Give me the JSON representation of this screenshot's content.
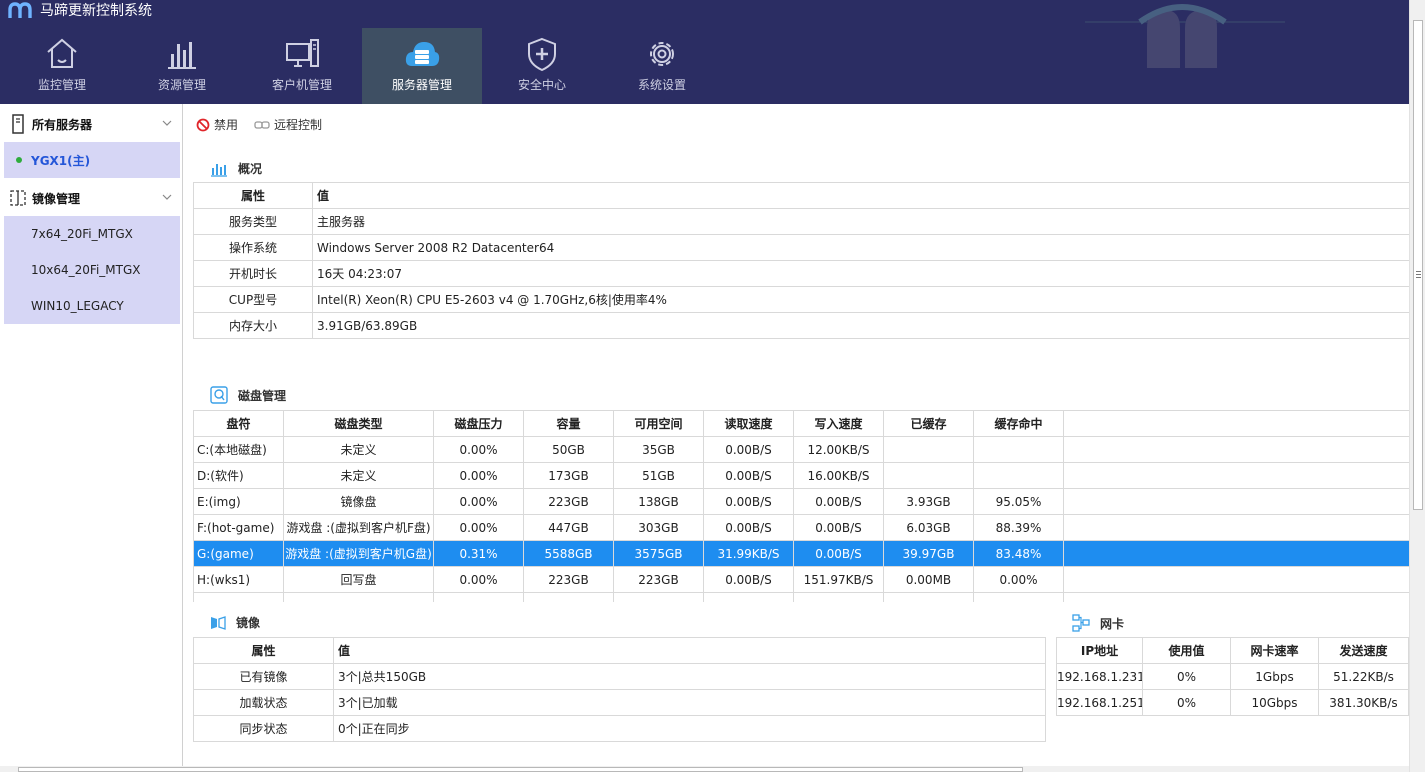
{
  "app": {
    "title": "马蹄更新控制系统"
  },
  "nav": [
    {
      "label": "监控管理",
      "icon": "home-icon",
      "active": false
    },
    {
      "label": "资源管理",
      "icon": "bar-chart-icon",
      "active": false
    },
    {
      "label": "客户机管理",
      "icon": "monitor-icon",
      "active": false
    },
    {
      "label": "服务器管理",
      "icon": "cloud-server-icon",
      "active": true
    },
    {
      "label": "安全中心",
      "icon": "shield-icon",
      "active": false
    },
    {
      "label": "系统设置",
      "icon": "gear-icon",
      "active": false
    }
  ],
  "sidebar": {
    "servers_group": "所有服务器",
    "server": "YGX1(主)",
    "images_group": "镜像管理",
    "images": [
      "7x64_20Fi_MTGX",
      "10x64_20Fi_MTGX",
      "WIN10_LEGACY"
    ]
  },
  "toolbar": {
    "disable": "禁用",
    "remote": "远程控制"
  },
  "overview": {
    "title": "概况",
    "headers": [
      "属性",
      "值"
    ],
    "rows": [
      [
        "服务类型",
        "主服务器"
      ],
      [
        "操作系统",
        "Windows Server 2008 R2 Datacenter64"
      ],
      [
        "开机时长",
        "16天 04:23:07"
      ],
      [
        "CUP型号",
        "Intel(R) Xeon(R) CPU E5-2603 v4 @ 1.70GHz,6核|使用率4%"
      ],
      [
        "内存大小",
        "3.91GB/63.89GB"
      ]
    ]
  },
  "disk": {
    "title": "磁盘管理",
    "headers": [
      "盘符",
      "磁盘类型",
      "磁盘压力",
      "容量",
      "可用空间",
      "读取速度",
      "写入速度",
      "已缓存",
      "缓存命中"
    ],
    "rows": [
      [
        "C:(本地磁盘)",
        "未定义",
        "0.00%",
        "50GB",
        "35GB",
        "0.00B/S",
        "12.00KB/S",
        "",
        ""
      ],
      [
        "D:(软件)",
        "未定义",
        "0.00%",
        "173GB",
        "51GB",
        "0.00B/S",
        "16.00KB/S",
        "",
        ""
      ],
      [
        "E:(img)",
        "镜像盘",
        "0.00%",
        "223GB",
        "138GB",
        "0.00B/S",
        "0.00B/S",
        "3.93GB",
        "95.05%"
      ],
      [
        "F:(hot-game)",
        "游戏盘 :(虚拟到客户机F盘)",
        "0.00%",
        "447GB",
        "303GB",
        "0.00B/S",
        "0.00B/S",
        "6.03GB",
        "88.39%"
      ],
      [
        "G:(game)",
        "游戏盘 :(虚拟到客户机G盘)",
        "0.31%",
        "5588GB",
        "3575GB",
        "31.99KB/S",
        "0.00B/S",
        "39.97GB",
        "83.48%"
      ],
      [
        "H:(wks1)",
        "回写盘",
        "0.00%",
        "223GB",
        "223GB",
        "0.00B/S",
        "151.97KB/S",
        "0.00MB",
        "0.00%"
      ]
    ],
    "selected_row": 4
  },
  "mirror": {
    "title": "镜像",
    "headers": [
      "属性",
      "值"
    ],
    "rows": [
      [
        "已有镜像",
        "3个|总共150GB"
      ],
      [
        "加载状态",
        "3个|已加载"
      ],
      [
        "同步状态",
        "0个|正在同步"
      ]
    ]
  },
  "nic": {
    "title": "网卡",
    "headers": [
      "IP地址",
      "使用值",
      "网卡速率",
      "发送速度"
    ],
    "rows": [
      [
        "192.168.1.231",
        "0%",
        "1Gbps",
        "51.22KB/s"
      ],
      [
        "192.168.1.251",
        "0%",
        "10Gbps",
        "381.30KB/s"
      ]
    ]
  },
  "colors": {
    "header_bg": "#2b2d63",
    "active_tab": "#3e4f63",
    "selected_row": "#1e8df0",
    "sidebar_item": "#d6d6f5",
    "accent": "#3aa0e8"
  }
}
